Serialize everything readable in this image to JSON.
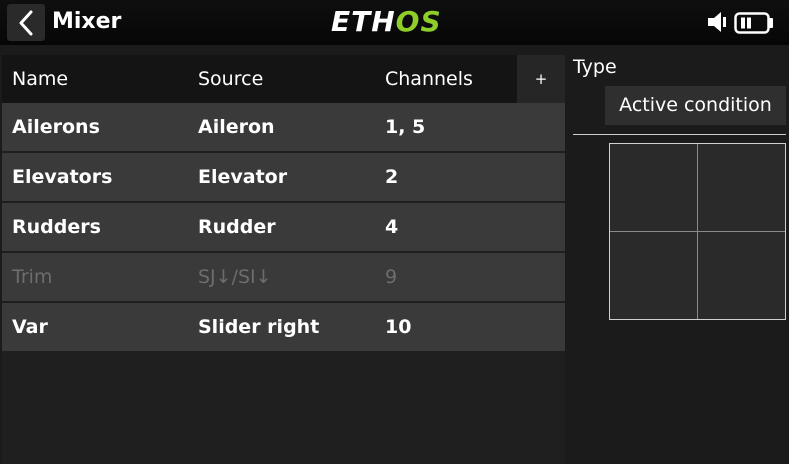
{
  "header": {
    "title": "Mixer",
    "logo_a": "ETH",
    "logo_b": "OS",
    "icons": [
      "back-chevron-icon",
      "speaker-icon",
      "battery-icon"
    ],
    "logo_accent": "#8fcd29"
  },
  "table": {
    "columns": [
      "Name",
      "Source",
      "Channels"
    ],
    "add_label": "+",
    "rows": [
      {
        "name": "Ailerons",
        "source": "Aileron",
        "channels": "1, 5",
        "enabled": true
      },
      {
        "name": "Elevators",
        "source": "Elevator",
        "channels": "2",
        "enabled": true
      },
      {
        "name": "Rudders",
        "source": "Rudder",
        "channels": "4",
        "enabled": true
      },
      {
        "name": "Trim",
        "source": "SJ↓/SI↓",
        "channels": "9",
        "enabled": false
      },
      {
        "name": "Var",
        "source": "Slider right",
        "channels": "10",
        "enabled": true
      }
    ]
  },
  "panel": {
    "type_label": "Type",
    "type_value": "Active condition"
  }
}
